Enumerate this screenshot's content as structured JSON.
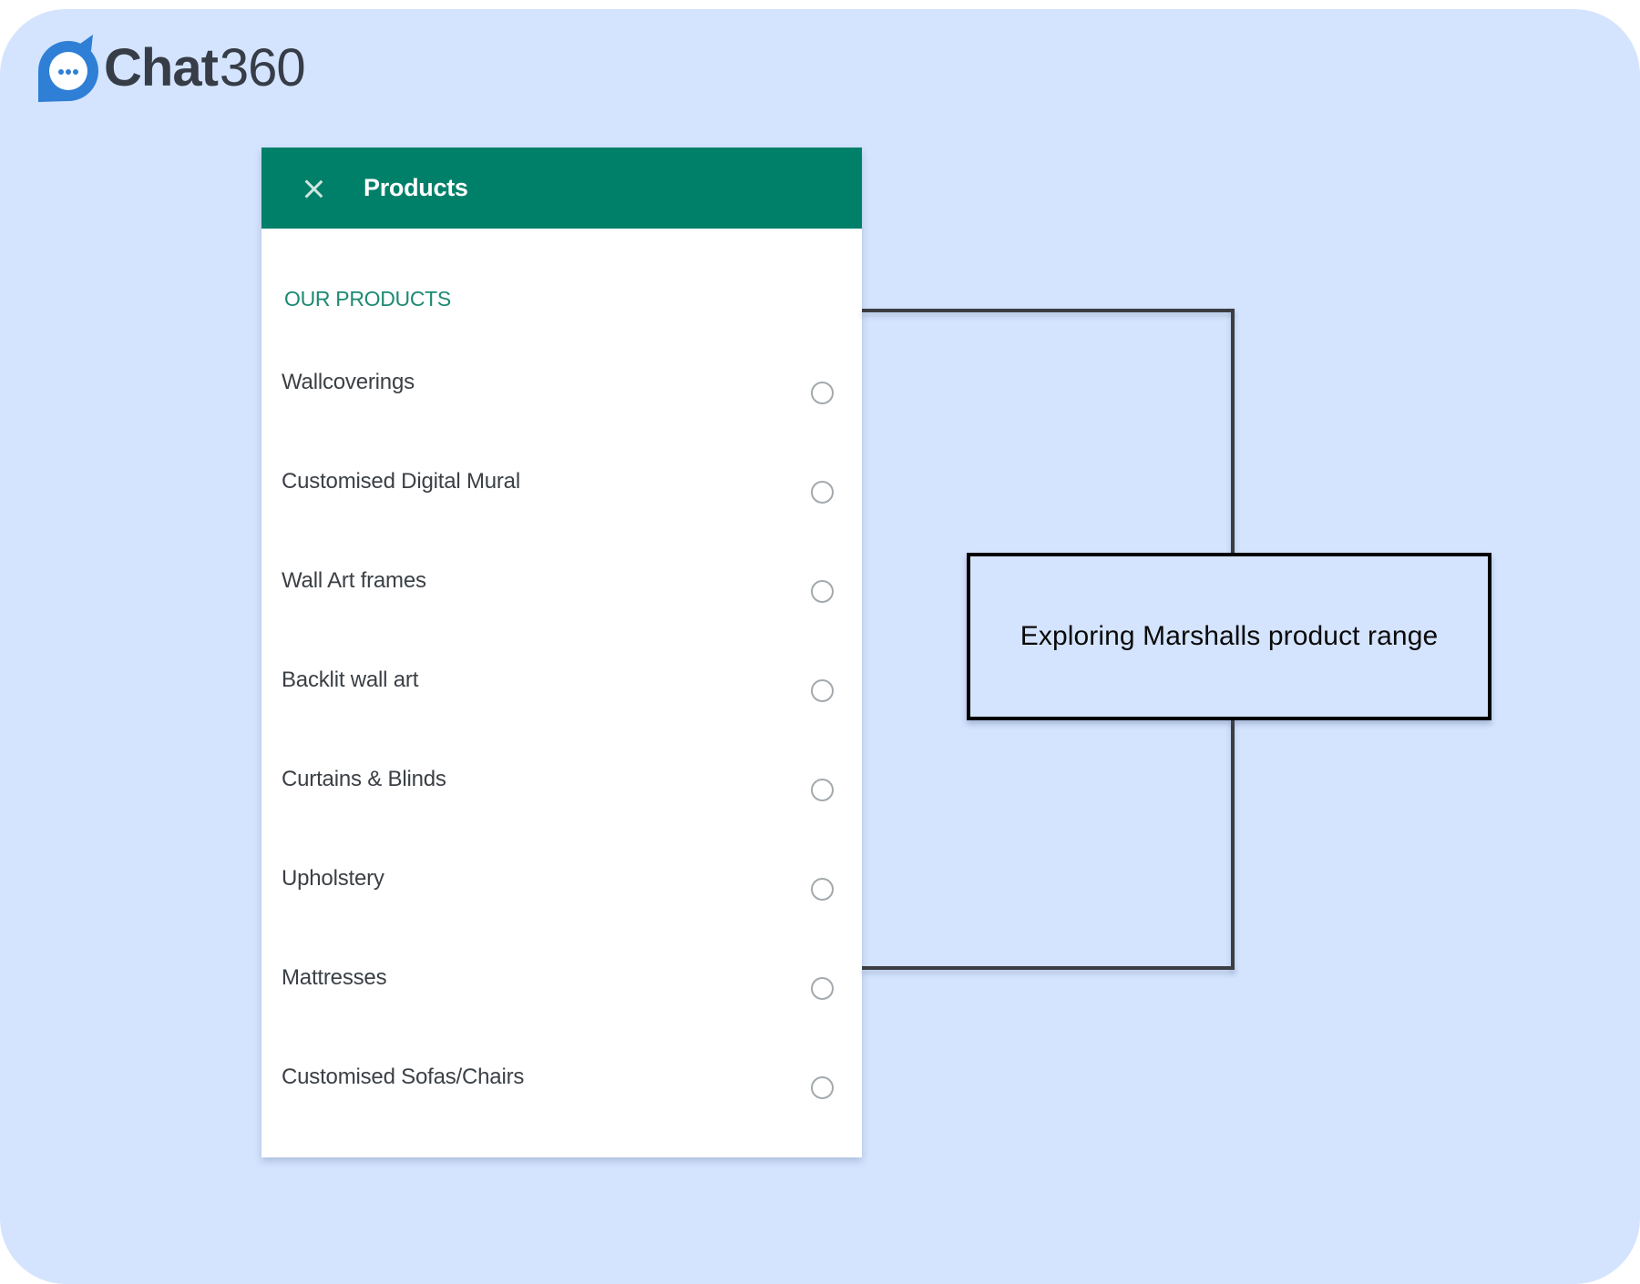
{
  "brand": {
    "name_bold": "Chat",
    "name_light": "360",
    "icon": "chat-bubble-icon",
    "color": "#2f7fd6"
  },
  "panel": {
    "title": "Products",
    "close_icon": "close-icon",
    "header_color": "#008069",
    "section_label": "OUR PRODUCTS",
    "items": [
      {
        "label": "Wallcoverings",
        "selected": false
      },
      {
        "label": "Customised Digital Mural",
        "selected": false
      },
      {
        "label": "Wall Art frames",
        "selected": false
      },
      {
        "label": "Backlit wall art",
        "selected": false
      },
      {
        "label": "Curtains & Blinds",
        "selected": false
      },
      {
        "label": "Upholstery",
        "selected": false
      },
      {
        "label": "Mattresses",
        "selected": false
      },
      {
        "label": "Customised Sofas/Chairs",
        "selected": false
      }
    ]
  },
  "annotation": {
    "text": "Exploring Marshalls product range"
  },
  "colors": {
    "background": "#d4e4fe",
    "section_label": "#1d8a72"
  }
}
